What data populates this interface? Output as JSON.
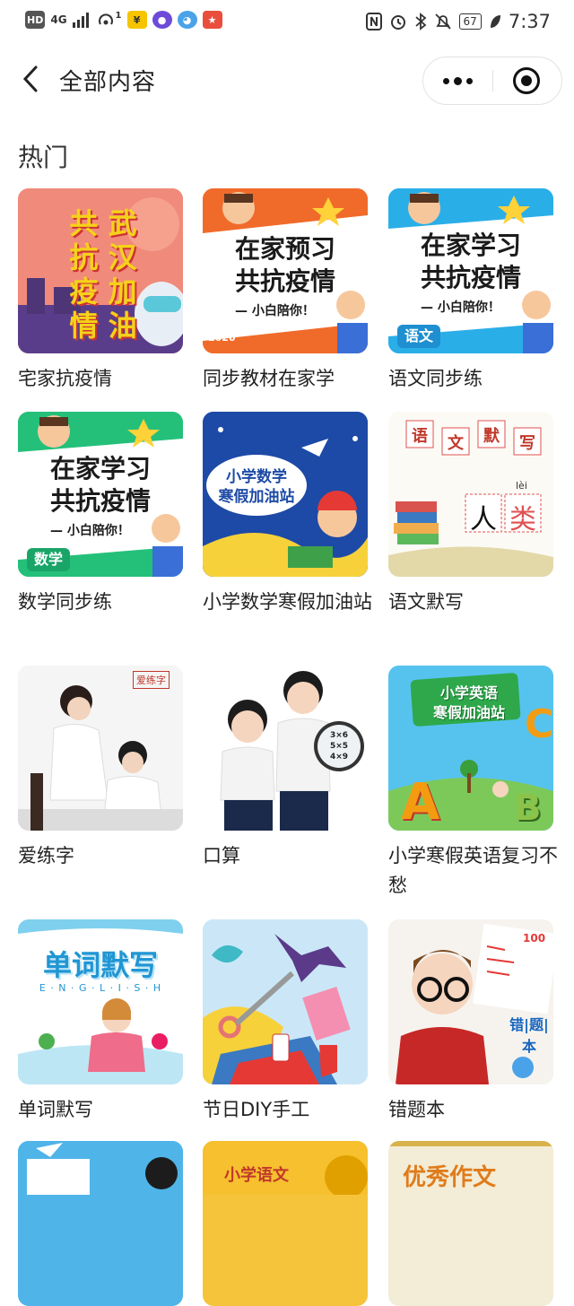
{
  "status_bar": {
    "left_items": [
      "HD",
      "4G",
      "1"
    ],
    "battery": "67",
    "time": "7:37"
  },
  "nav": {
    "title": "全部内容"
  },
  "section": {
    "title": "热门"
  },
  "items": [
    {
      "label": "宅家抗疫情",
      "thumb_text": [
        "共",
        "武",
        "抗",
        "汉",
        "疫",
        "加",
        "情",
        "油"
      ]
    },
    {
      "label": "同步教材在家学",
      "thumb_text": [
        "在家预习",
        "共抗疫情",
        "— 小白陪你！",
        "2020"
      ]
    },
    {
      "label": "语文同步练",
      "thumb_text": [
        "在家学习",
        "共抗疫情",
        "— 小白陪你！",
        "语文"
      ]
    },
    {
      "label": "数学同步练",
      "thumb_text": [
        "在家学习",
        "共抗疫情",
        "— 小白陪你！",
        "数学"
      ]
    },
    {
      "label": "小学数学寒假加油站",
      "thumb_text": [
        "小学数学",
        "寒假加油站"
      ]
    },
    {
      "label": "语文默写",
      "thumb_text": [
        "语",
        "文",
        "默",
        "写",
        "人",
        "类",
        "lèi"
      ]
    },
    {
      "label": "爱练字",
      "thumb_text": [
        "爱练字"
      ]
    },
    {
      "label": "口算",
      "thumb_text": [
        "3×6",
        "5×5",
        "4×9"
      ]
    },
    {
      "label": "小学寒假英语复习不愁",
      "thumb_text": [
        "小学英语",
        "寒假加油站",
        "A",
        "B",
        "C"
      ]
    },
    {
      "label": "单词默写",
      "thumb_text": [
        "单词默写",
        "E · N · G · L · I · S · H"
      ]
    },
    {
      "label": "节日DIY手工",
      "thumb_text": []
    },
    {
      "label": "错题本",
      "thumb_text": [
        "错",
        "题",
        "本",
        "100"
      ]
    },
    {
      "label": "",
      "thumb_text": []
    },
    {
      "label": "",
      "thumb_text": [
        "小学语文"
      ]
    },
    {
      "label": "",
      "thumb_text": [
        "优秀作文"
      ]
    }
  ]
}
